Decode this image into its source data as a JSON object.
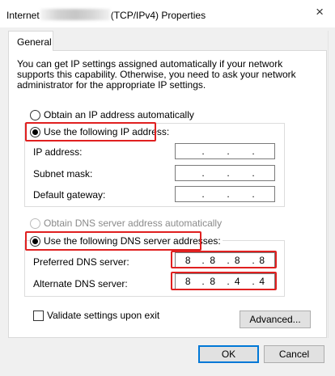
{
  "window": {
    "title_prefix": "Internet",
    "title_suffix": "(TCP/IPv4) Properties",
    "close_glyph": "×"
  },
  "tabs": [
    {
      "label": "General"
    }
  ],
  "description": "You can get IP settings assigned automatically if your network supports this capability. Otherwise, you need to ask your network administrator for the appropriate IP settings.",
  "ip_section": {
    "auto_option": "Obtain an IP address automatically",
    "manual_option": "Use the following IP address:",
    "selected": "manual",
    "fields": [
      {
        "label": "IP address:",
        "octets": [
          "",
          "",
          "",
          ""
        ]
      },
      {
        "label": "Subnet mask:",
        "octets": [
          "",
          "",
          "",
          ""
        ]
      },
      {
        "label": "Default gateway:",
        "octets": [
          "",
          "",
          "",
          ""
        ]
      }
    ]
  },
  "dns_section": {
    "auto_option": "Obtain DNS server address automatically",
    "manual_option": "Use the following DNS server addresses:",
    "selected": "manual",
    "fields": [
      {
        "label": "Preferred DNS server:",
        "octets": [
          "8",
          "8",
          "8",
          "8"
        ]
      },
      {
        "label": "Alternate DNS server:",
        "octets": [
          "8",
          "8",
          "4",
          "4"
        ]
      }
    ]
  },
  "validate_checkbox": {
    "label": "Validate settings upon exit",
    "checked": false
  },
  "buttons": {
    "advanced": "Advanced...",
    "ok": "OK",
    "cancel": "Cancel"
  },
  "colors": {
    "highlight": "#e02020",
    "default_button_border": "#0078d7"
  }
}
